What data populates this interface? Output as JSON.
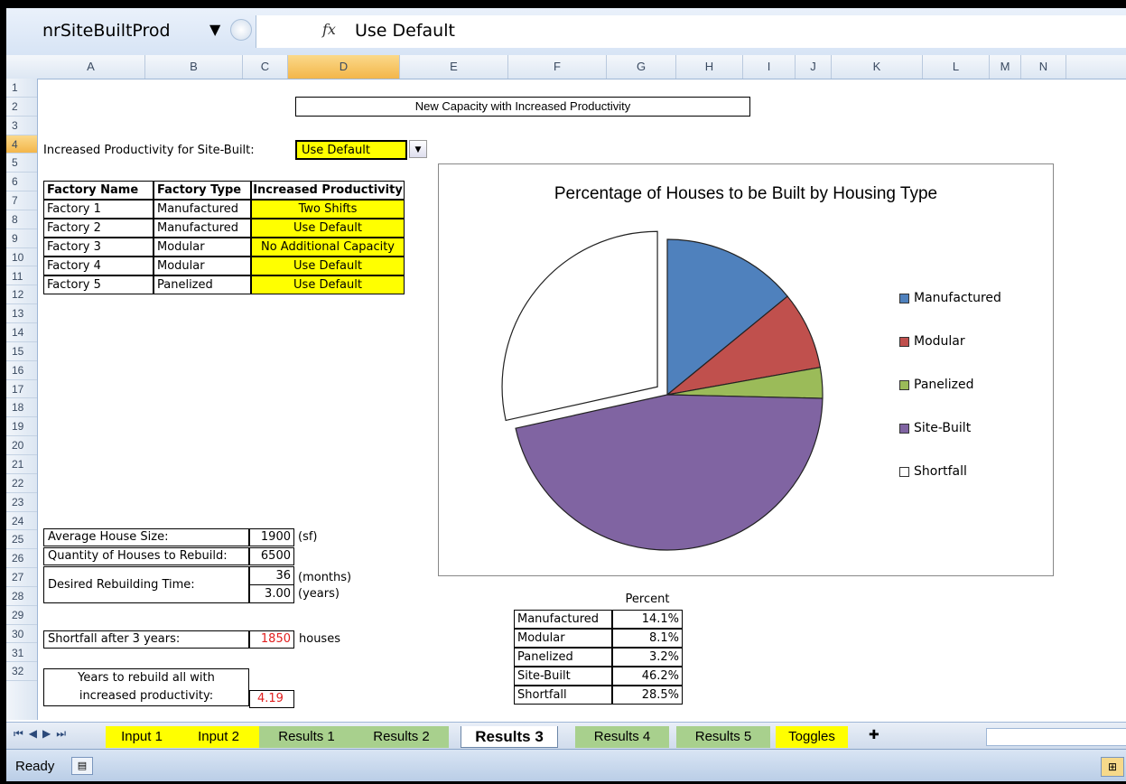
{
  "formula_bar": {
    "name_box": "nrSiteBuiltProd",
    "fx": "fx",
    "value": "Use Default"
  },
  "columns": [
    "A",
    "B",
    "C",
    "D",
    "E",
    "F",
    "G",
    "H",
    "I",
    "J",
    "K",
    "L",
    "M",
    "N"
  ],
  "rows": [
    "1",
    "2",
    "3",
    "4",
    "5",
    "6",
    "7",
    "8",
    "9",
    "10",
    "11",
    "12",
    "13",
    "14",
    "15",
    "16",
    "17",
    "18",
    "19",
    "20",
    "21",
    "22",
    "23",
    "24",
    "25",
    "26",
    "27",
    "28",
    "29",
    "30",
    "31",
    "32"
  ],
  "sheet": {
    "title": "New Capacity with Increased Productivity",
    "site_label": "Increased Productivity for Site-Built:",
    "site_value": "Use Default",
    "factory_headers": [
      "Factory Name",
      "Factory Type",
      "Increased Productivity"
    ],
    "factories": [
      {
        "name": "Factory 1",
        "type": "Manufactured",
        "prod": "Two Shifts"
      },
      {
        "name": "Factory 2",
        "type": "Manufactured",
        "prod": "Use Default"
      },
      {
        "name": "Factory 3",
        "type": "Modular",
        "prod": "No Additional Capacity"
      },
      {
        "name": "Factory 4",
        "type": "Modular",
        "prod": "Use Default"
      },
      {
        "name": "Factory 5",
        "type": "Panelized",
        "prod": "Use Default"
      }
    ],
    "avg_size_label": "Average House Size:",
    "avg_size": "1900",
    "avg_size_unit": "(sf)",
    "qty_label": "Quantity of Houses to Rebuild:",
    "qty": "6500",
    "time_label": "Desired Rebuilding Time:",
    "time_months": "36",
    "months_unit": "(months)",
    "time_years": "3.00",
    "years_unit": "(years)",
    "shortfall_label": "Shortfall after 3 years:",
    "shortfall": "1850",
    "shortfall_unit": "houses",
    "years_label_1": "Years to rebuild all with",
    "years_label_2": "increased productivity:",
    "years_value": "4.19",
    "percent_header": "Percent",
    "percent_rows": [
      {
        "label": "Manufactured",
        "value": "14.1%"
      },
      {
        "label": "Modular",
        "value": "8.1%"
      },
      {
        "label": "Panelized",
        "value": "3.2%"
      },
      {
        "label": "Site-Built",
        "value": "46.2%"
      },
      {
        "label": "Shortfall",
        "value": "28.5%"
      }
    ]
  },
  "chart_data": {
    "type": "pie",
    "title": "Percentage of Houses to be Built by Housing Type",
    "categories": [
      "Manufactured",
      "Modular",
      "Panelized",
      "Site-Built",
      "Shortfall"
    ],
    "values": [
      14.1,
      8.1,
      3.2,
      46.2,
      28.5
    ],
    "colors": [
      "#4f81bd",
      "#c0504d",
      "#9bbb59",
      "#8064a2",
      "#ffffff"
    ],
    "exploded": [
      "Shortfall"
    ],
    "legend_position": "right"
  },
  "tabs": [
    {
      "label": "Input 1",
      "style": "y"
    },
    {
      "label": "Input 2",
      "style": "y"
    },
    {
      "label": "Results 1",
      "style": "g"
    },
    {
      "label": "Results 2",
      "style": "g"
    },
    {
      "label": "Results 3",
      "style": "active"
    },
    {
      "label": "Results 4",
      "style": "g"
    },
    {
      "label": "Results 5",
      "style": "g"
    },
    {
      "label": "Toggles",
      "style": "y"
    }
  ],
  "status": {
    "ready": "Ready"
  }
}
